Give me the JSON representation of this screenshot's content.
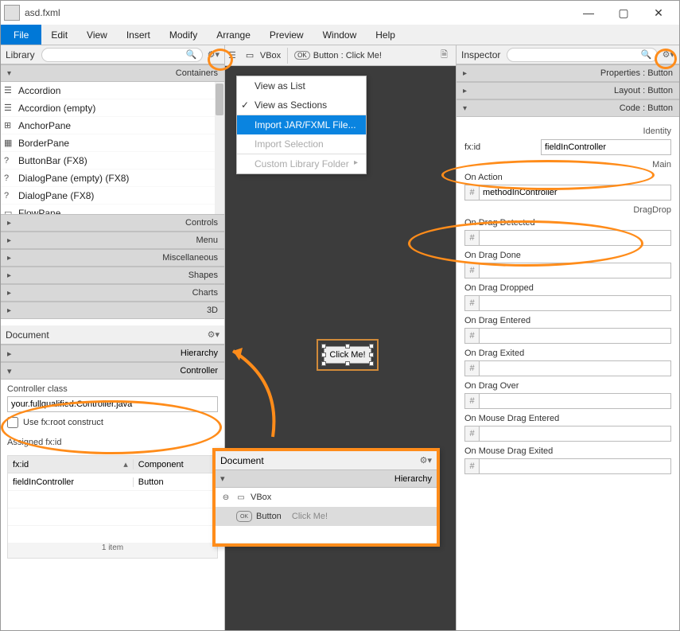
{
  "window": {
    "title": "asd.fxml"
  },
  "menubar": [
    "File",
    "Edit",
    "View",
    "Insert",
    "Modify",
    "Arrange",
    "Preview",
    "Window",
    "Help"
  ],
  "library": {
    "title": "Library",
    "search": "",
    "sections": {
      "containers": {
        "label": "Containers",
        "items": [
          "Accordion",
          "Accordion  (empty)",
          "AnchorPane",
          "BorderPane",
          "ButtonBar   (FX8)",
          "DialogPane (empty)   (FX8)",
          "DialogPane   (FX8)",
          "FlowPane"
        ]
      },
      "others": [
        "Controls",
        "Menu",
        "Miscellaneous",
        "Shapes",
        "Charts",
        "3D"
      ]
    }
  },
  "popup": {
    "view_list": "View as List",
    "view_sections": "View as Sections",
    "import_jar": "Import JAR/FXML File...",
    "import_sel": "Import Selection",
    "custom_folder": "Custom Library Folder"
  },
  "breadcrumb": {
    "vbox": "VBox",
    "button": "Button : Click Me!"
  },
  "document": {
    "title": "Document",
    "hierarchy": "Hierarchy",
    "controller": "Controller",
    "ctl_class_label": "Controller class",
    "ctl_class_value": "your.fullqualified.Controller.java",
    "use_fxroot": "Use fx:root construct",
    "assigned_label": "Assigned fx:id",
    "tbl": {
      "col1": "fx:id",
      "col2": "Component",
      "row1c1": "fieldInController",
      "row1c2": "Button",
      "footer": "1 item"
    }
  },
  "editor": {
    "button_text": "Click Me!"
  },
  "hierpop": {
    "title": "Document",
    "section": "Hierarchy",
    "vbox": "VBox",
    "btn_label": "Button",
    "btn_text": "Click Me!"
  },
  "inspector": {
    "title": "Inspector",
    "sections": {
      "properties": "Properties : Button",
      "layout": "Layout : Button",
      "code": "Code : Button"
    },
    "identity": "Identity",
    "fxid_label": "fx:id",
    "fxid_value": "fieldInController",
    "main": "Main",
    "onaction_label": "On Action",
    "onaction_value": "methodInController",
    "dragdrop": "DragDrop",
    "drag_fields": [
      "On Drag Detected",
      "On Drag Done",
      "On Drag Dropped",
      "On Drag Entered",
      "On Drag Exited",
      "On Drag Over",
      "On Mouse Drag Entered",
      "On Mouse Drag Exited"
    ]
  }
}
